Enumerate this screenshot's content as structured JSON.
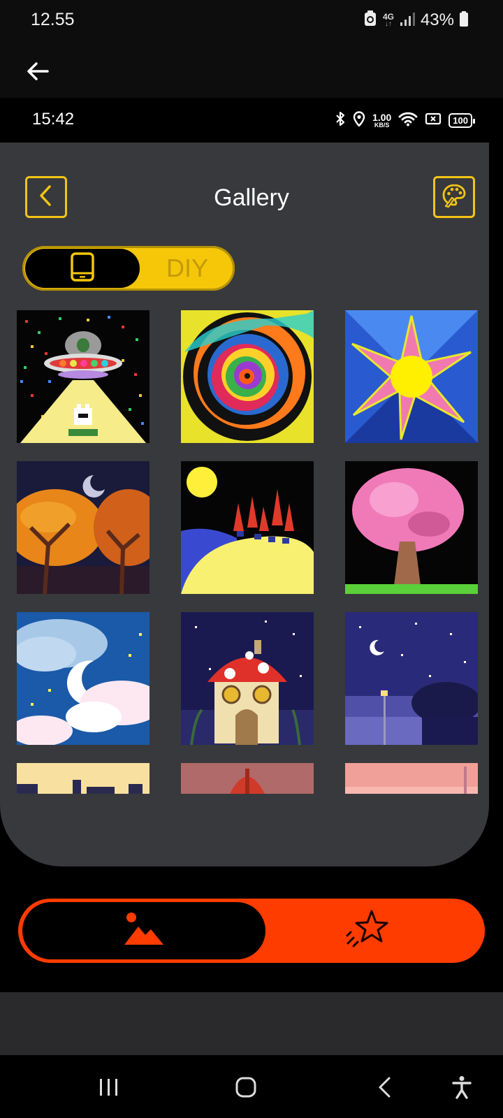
{
  "outer_status": {
    "time": "12.55",
    "network": "4G",
    "battery": "43%"
  },
  "inner_status": {
    "time": "15:42",
    "speed_value": "1.00",
    "speed_unit": "KB/S",
    "battery": "100"
  },
  "header": {
    "title": "Gallery"
  },
  "toggle": {
    "diy_label": "DIY",
    "selected": "device"
  },
  "gallery": {
    "items": [
      "ufo-alien-image",
      "rainbow-swirl-image",
      "sun-star-image",
      "autumn-trees-image",
      "night-hills-image",
      "pink-tree-image",
      "moon-clouds-image",
      "mushroom-house-image",
      "night-street-image",
      "partial-image-1",
      "partial-image-2",
      "partial-image-3"
    ]
  },
  "bottom_nav": {
    "active": "gallery",
    "colors": {
      "accent": "#ff3c00"
    }
  },
  "colors": {
    "accent_yellow": "#f5c708",
    "card_bg": "#38393c"
  }
}
